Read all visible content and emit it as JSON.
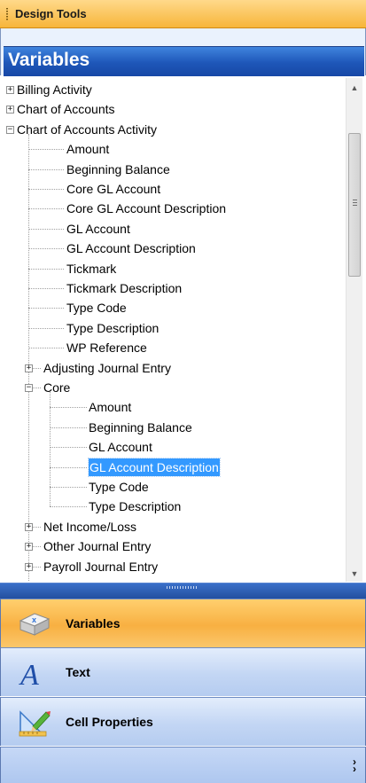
{
  "window": {
    "title": "Design Tools"
  },
  "panel": {
    "header": "Variables"
  },
  "tree": {
    "nodes": [
      {
        "label": "Billing Activity",
        "level": 0,
        "expander": "+"
      },
      {
        "label": "Chart of Accounts",
        "level": 0,
        "expander": "+"
      },
      {
        "label": "Chart of Accounts Activity",
        "level": 0,
        "expander": "-"
      },
      {
        "label": "Amount",
        "level": 1
      },
      {
        "label": "Beginning Balance",
        "level": 1
      },
      {
        "label": "Core GL Account",
        "level": 1
      },
      {
        "label": "Core GL Account Description",
        "level": 1
      },
      {
        "label": "GL Account",
        "level": 1
      },
      {
        "label": "GL Account Description",
        "level": 1
      },
      {
        "label": "Tickmark",
        "level": 1
      },
      {
        "label": "Tickmark Description",
        "level": 1
      },
      {
        "label": "Type Code",
        "level": 1
      },
      {
        "label": "Type Description",
        "level": 1
      },
      {
        "label": "WP Reference",
        "level": 1
      },
      {
        "label": "Adjusting Journal Entry",
        "level": 1,
        "expander": "+"
      },
      {
        "label": "Core",
        "level": 1,
        "expander": "-"
      },
      {
        "label": "Amount",
        "level": 2
      },
      {
        "label": "Beginning Balance",
        "level": 2
      },
      {
        "label": "GL Account",
        "level": 2
      },
      {
        "label": "GL Account Description",
        "level": 2,
        "selected": true
      },
      {
        "label": "Type Code",
        "level": 2
      },
      {
        "label": "Type Description",
        "level": 2
      },
      {
        "label": "Net Income/Loss",
        "level": 1,
        "expander": "+"
      },
      {
        "label": "Other Journal Entry",
        "level": 1,
        "expander": "+"
      },
      {
        "label": "Payroll Journal Entry",
        "level": 1,
        "expander": "+"
      }
    ]
  },
  "nav": {
    "buttons": [
      {
        "label": "Variables",
        "icon": "variables-cube-icon",
        "active": true
      },
      {
        "label": "Text",
        "icon": "text-letter-a-icon",
        "active": false
      },
      {
        "label": "Cell Properties",
        "icon": "cell-properties-ruler-pencil-icon",
        "active": false
      }
    ],
    "overflow_icon": "chevron-double-down-icon"
  },
  "colors": {
    "title_bar": "#f7b53a",
    "header_bar": "#1e56b8",
    "selection": "#3399ff",
    "nav_active": "#f8b042",
    "nav_normal": "#c3d6f4"
  }
}
